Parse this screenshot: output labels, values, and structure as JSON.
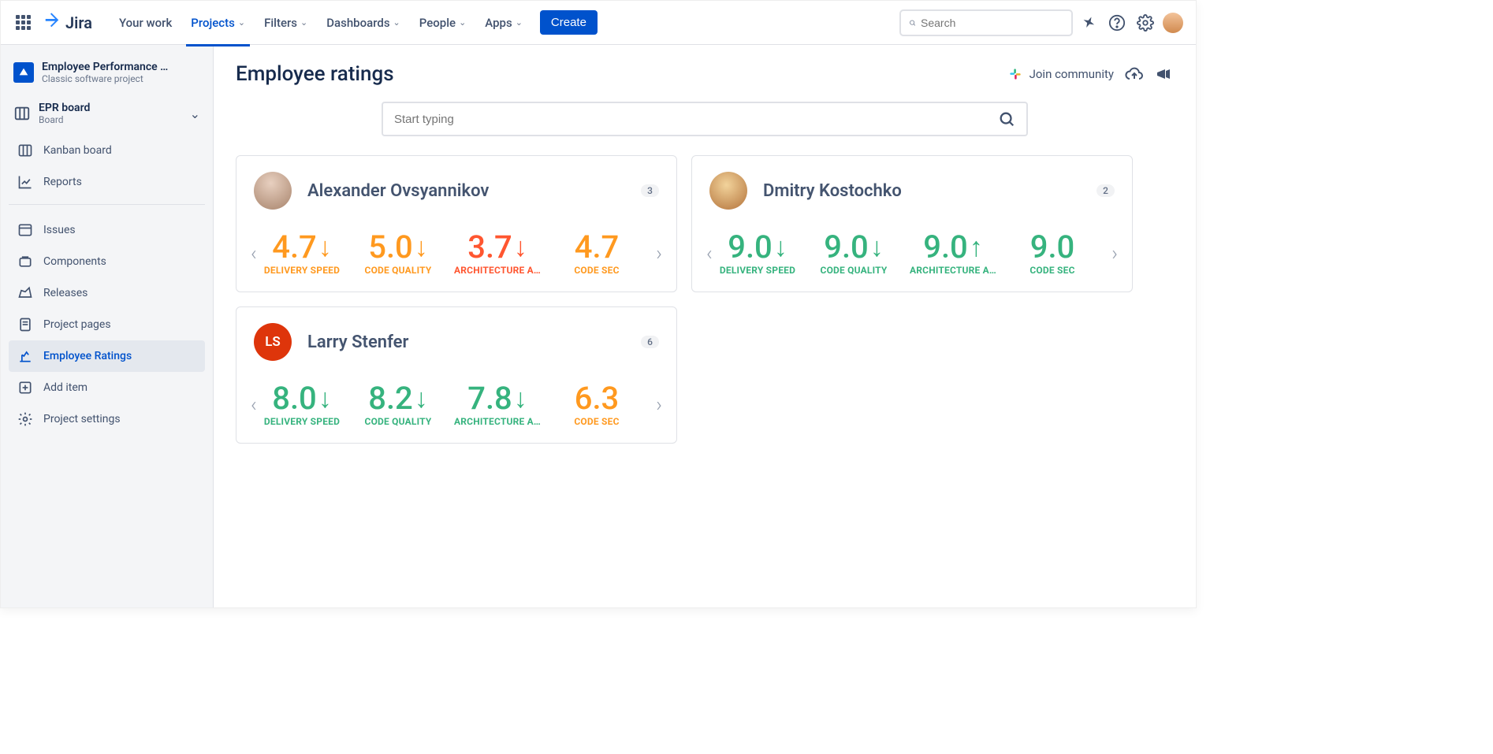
{
  "top": {
    "logo_text": "Jira",
    "nav": [
      "Your work",
      "Projects",
      "Filters",
      "Dashboards",
      "People",
      "Apps"
    ],
    "active_nav_index": 1,
    "create": "Create",
    "search_placeholder": "Search"
  },
  "sidebar": {
    "project_name": "Employee Performance …",
    "project_type": "Classic software project",
    "board_name": "EPR board",
    "board_sub": "Board",
    "items_top": [
      "Kanban board",
      "Reports"
    ],
    "items_mid": [
      "Issues",
      "Components",
      "Releases",
      "Project pages",
      "Employee Ratings",
      "Add item",
      "Project settings"
    ],
    "active_mid_index": 4
  },
  "main": {
    "title": "Employee ratings",
    "join_label": "Join community",
    "filter_placeholder": "Start typing"
  },
  "employees": [
    {
      "name": "Alexander Ovsyannikov",
      "badge": "3",
      "avatar_class": "avatar-img-1",
      "initials": "",
      "metrics": [
        {
          "value": "4.7",
          "dir": "↓",
          "label": "DELIVERY SPEED",
          "color": "c-orange"
        },
        {
          "value": "5.0",
          "dir": "↓",
          "label": "CODE QUALITY",
          "color": "c-orange"
        },
        {
          "value": "3.7",
          "dir": "↓",
          "label": "ARCHITECTURE A…",
          "color": "c-red"
        },
        {
          "value": "4.7",
          "dir": "",
          "label": "CODE SEC",
          "color": "c-orange"
        }
      ]
    },
    {
      "name": "Dmitry Kostochko",
      "badge": "2",
      "avatar_class": "avatar-img-2",
      "initials": "",
      "metrics": [
        {
          "value": "9.0",
          "dir": "↓",
          "label": "DELIVERY SPEED",
          "color": "c-green"
        },
        {
          "value": "9.0",
          "dir": "↓",
          "label": "CODE QUALITY",
          "color": "c-green"
        },
        {
          "value": "9.0",
          "dir": "↑",
          "label": "ARCHITECTURE A…",
          "color": "c-green"
        },
        {
          "value": "9.0",
          "dir": "",
          "label": "CODE SEC",
          "color": "c-green"
        }
      ]
    },
    {
      "name": "Larry Stenfer",
      "badge": "6",
      "avatar_class": "avatar-ls",
      "initials": "LS",
      "metrics": [
        {
          "value": "8.0",
          "dir": "↓",
          "label": "DELIVERY SPEED",
          "color": "c-green"
        },
        {
          "value": "8.2",
          "dir": "↓",
          "label": "CODE QUALITY",
          "color": "c-green"
        },
        {
          "value": "7.8",
          "dir": "↓",
          "label": "ARCHITECTURE A…",
          "color": "c-green"
        },
        {
          "value": "6.3",
          "dir": "",
          "label": "CODE SEC",
          "color": "c-orange"
        }
      ]
    }
  ]
}
